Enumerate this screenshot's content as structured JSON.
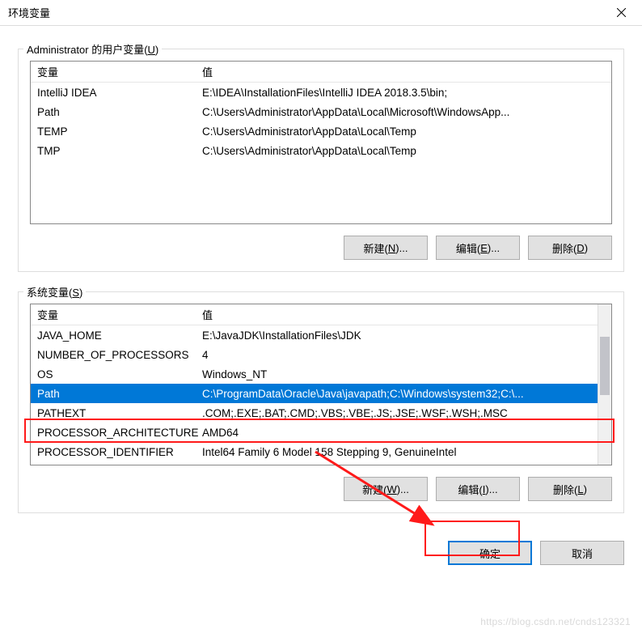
{
  "titlebar": {
    "title": "环境变量"
  },
  "userVars": {
    "label_prefix": "Administrator 的用户变量(",
    "label_key": "U",
    "label_suffix": ")",
    "header": {
      "name": "变量",
      "value": "值"
    },
    "rows": [
      {
        "name": "IntelliJ IDEA",
        "value": "E:\\IDEA\\InstallationFiles\\IntelliJ IDEA 2018.3.5\\bin;"
      },
      {
        "name": "Path",
        "value": "C:\\Users\\Administrator\\AppData\\Local\\Microsoft\\WindowsApp..."
      },
      {
        "name": "TEMP",
        "value": "C:\\Users\\Administrator\\AppData\\Local\\Temp"
      },
      {
        "name": "TMP",
        "value": "C:\\Users\\Administrator\\AppData\\Local\\Temp"
      }
    ],
    "buttons": {
      "new_pre": "新建(",
      "new_key": "N",
      "new_suf": ")...",
      "edit_pre": "编辑(",
      "edit_key": "E",
      "edit_suf": ")...",
      "del_pre": "删除(",
      "del_key": "D",
      "del_suf": ")"
    }
  },
  "sysVars": {
    "label_prefix": "系统变量(",
    "label_key": "S",
    "label_suffix": ")",
    "header": {
      "name": "变量",
      "value": "值"
    },
    "rows": [
      {
        "name": "JAVA_HOME",
        "value": "E:\\JavaJDK\\InstallationFiles\\JDK"
      },
      {
        "name": "NUMBER_OF_PROCESSORS",
        "value": "4"
      },
      {
        "name": "OS",
        "value": "Windows_NT"
      },
      {
        "name": "Path",
        "value": "C:\\ProgramData\\Oracle\\Java\\javapath;C:\\Windows\\system32;C:\\...",
        "selected": true
      },
      {
        "name": "PATHEXT",
        "value": ".COM;.EXE;.BAT;.CMD;.VBS;.VBE;.JS;.JSE;.WSF;.WSH;.MSC"
      },
      {
        "name": "PROCESSOR_ARCHITECTURE",
        "value": "AMD64"
      },
      {
        "name": "PROCESSOR_IDENTIFIER",
        "value": "Intel64 Family 6 Model 158 Stepping 9, GenuineIntel"
      }
    ],
    "buttons": {
      "new_pre": "新建(",
      "new_key": "W",
      "new_suf": ")...",
      "edit_pre": "编辑(",
      "edit_key": "I",
      "edit_suf": ")...",
      "del_pre": "删除(",
      "del_key": "L",
      "del_suf": ")"
    }
  },
  "footer": {
    "ok": "确定",
    "cancel": "取消"
  },
  "watermark": "https://blog.csdn.net/cnds123321"
}
